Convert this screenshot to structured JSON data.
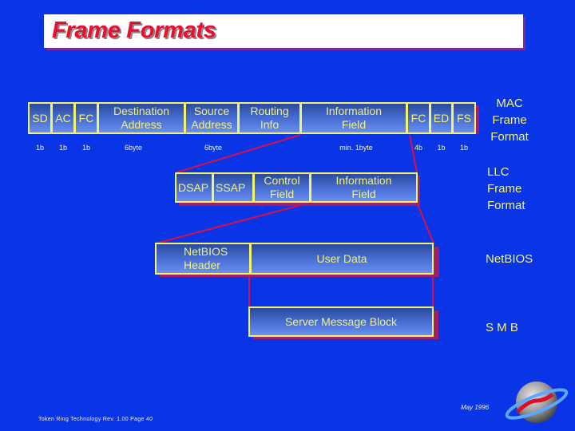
{
  "title": "Frame Formats",
  "mac_frame": {
    "fields": [
      {
        "label": "SD",
        "size": "1b"
      },
      {
        "label": "AC",
        "size": "1b"
      },
      {
        "label": "FC",
        "size": "1b"
      },
      {
        "label": "Destination\nAddress",
        "size": "6byte"
      },
      {
        "label": "Source\nAddress",
        "size": "6byte"
      },
      {
        "label": "Routing\nInfo",
        "size": ""
      },
      {
        "label": "Information\nField",
        "size": "min. 1byte"
      },
      {
        "label": "FC",
        "size": "4b"
      },
      {
        "label": "ED",
        "size": "1b"
      },
      {
        "label": "FS",
        "size": "1b"
      }
    ],
    "label": "MAC\nFrame\nFormat"
  },
  "llc_frame": {
    "fields": [
      {
        "label": "DSAP"
      },
      {
        "label": "SSAP"
      },
      {
        "label": "Control\nField"
      },
      {
        "label": "Information\nField"
      }
    ],
    "label": "LLC\nFrame\nFormat"
  },
  "netbios_frame": {
    "fields": [
      {
        "label": "NetBIOS\nHeader"
      },
      {
        "label": "User Data"
      }
    ],
    "label": "NetBIOS"
  },
  "smb_frame": {
    "fields": [
      {
        "label": "Server Message Block"
      }
    ],
    "label": "S M B"
  },
  "footer": {
    "left": "Token Ring Technology   Rev. 1.00   Page 40",
    "date": "May 1996"
  },
  "colors": {
    "background": "#0a35e6",
    "title": "#e8102e",
    "box_border": "#f4f46a",
    "connector": "#d8104a"
  }
}
